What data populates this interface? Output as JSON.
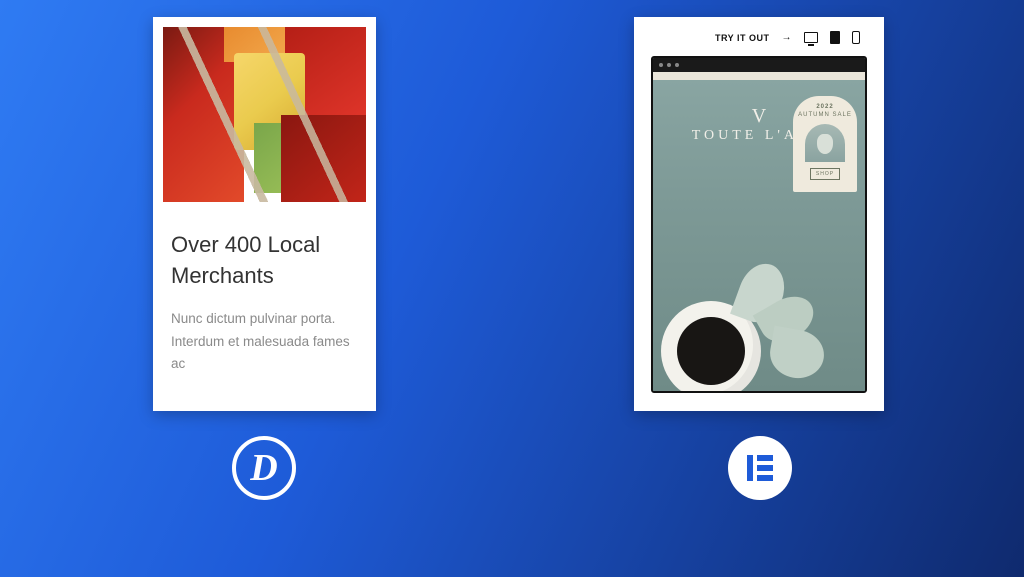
{
  "left_card": {
    "title": "Over 400 Local Merchants",
    "description": "Nunc dictum pulvinar porta. Interdum et malesuada fames ac"
  },
  "right_card": {
    "try_label": "TRY IT OUT",
    "arrow": "→",
    "brand_name": "TOUTE L'ANN",
    "promo": {
      "year": "2022",
      "label": "AUTUMN SALE",
      "button": "SHOP"
    }
  },
  "logos": {
    "divi_letter": "D"
  }
}
